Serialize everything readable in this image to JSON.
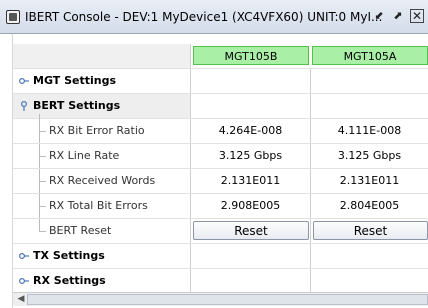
{
  "window": {
    "title": "IBERT Console - DEV:1 MyDevice1 (XC4VFX60) UNIT:0 MyI...",
    "restore_glyph": "⬋",
    "maximize_glyph": "⬈",
    "close_glyph": "✕"
  },
  "columns": [
    "MGT105B",
    "MGT105A"
  ],
  "tree": {
    "mgt_settings": {
      "label": "MGT Settings",
      "expanded": false
    },
    "bert_settings": {
      "label": "BERT Settings",
      "expanded": true,
      "rows": [
        {
          "label": "RX Bit Error Ratio",
          "values": [
            "4.264E-008",
            "4.111E-008"
          ]
        },
        {
          "label": "RX Line Rate",
          "values": [
            "3.125 Gbps",
            "3.125 Gbps"
          ]
        },
        {
          "label": "RX Received Words",
          "values": [
            "2.131E011",
            "2.131E011"
          ]
        },
        {
          "label": "RX Total Bit Errors",
          "values": [
            "2.908E005",
            "2.804E005"
          ]
        }
      ],
      "reset_row": {
        "label": "BERT Reset",
        "buttons": [
          "Reset",
          "Reset"
        ]
      }
    },
    "tx_settings": {
      "label": "TX Settings",
      "expanded": false
    },
    "rx_settings": {
      "label": "RX Settings",
      "expanded": false
    }
  },
  "colors": {
    "column_header_bg": "#a9f0a6",
    "column_header_border": "#52c24d",
    "group_bg": "#eeeeee"
  }
}
